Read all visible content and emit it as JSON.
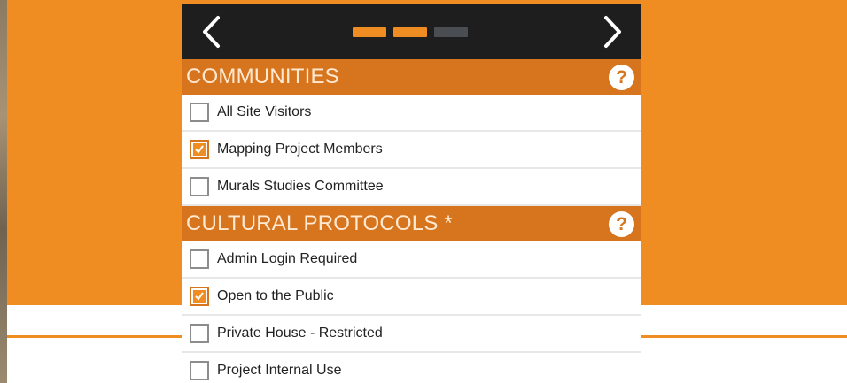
{
  "colors": {
    "accent": "#ef8d22",
    "section_header": "#d7751f",
    "topbar": "#1e1e1e",
    "progress_inactive": "#4a4e52"
  },
  "nav": {
    "prev_icon": "chevron-left-icon",
    "next_icon": "chevron-right-icon",
    "progress": {
      "steps": 3,
      "completed": 2
    }
  },
  "communities": {
    "title": "COMMUNITIES",
    "help": "?",
    "items": [
      {
        "label": "All Site Visitors",
        "checked": false
      },
      {
        "label": "Mapping Project Members",
        "checked": true
      },
      {
        "label": "Murals Studies Committee",
        "checked": false
      }
    ]
  },
  "protocols": {
    "title": "CULTURAL PROTOCOLS *",
    "help": "?",
    "items": [
      {
        "label": "Admin Login Required",
        "checked": false
      },
      {
        "label": "Open to the Public",
        "checked": true
      },
      {
        "label": "Private House - Restricted",
        "checked": false
      },
      {
        "label": "Project Internal Use",
        "checked": false
      }
    ]
  }
}
